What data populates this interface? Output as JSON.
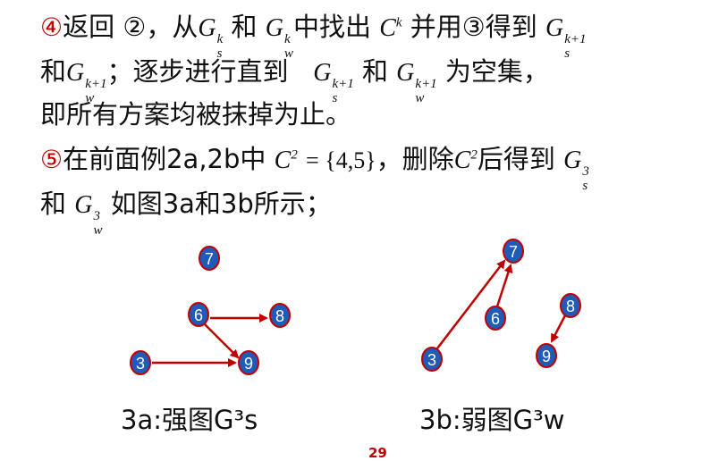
{
  "text": {
    "l1_circ": "④",
    "l1_a": "返回",
    "l1_circ2": "②",
    "l1_b": "，从",
    "l1_c": "和",
    "l1_d": "中找出",
    "l1_e": "并用",
    "l1_circ3": "③",
    "l1_f": "得到",
    "l2_a": "和",
    "l2_b": "；逐步进行直到",
    "l2_c": "和",
    "l2_d": "为空集，",
    "l3": "即所有方案均被抹掉为止。",
    "l4_circ": "⑤",
    "l4_a": "在前面例2a,2b中",
    "l4_set": "= {4,5}",
    "l4_b": "，删除",
    "l4_c": "后得到",
    "l5_a": "和",
    "l5_b": "如图3a和3b所示；",
    "G": "G",
    "C": "C",
    "k": "k",
    "kp1": "k+1",
    "sub_s": "s",
    "sub_w": "w",
    "sq": "2",
    "cube": "3"
  },
  "captions": {
    "fig_a": "3a:强图G³s",
    "fig_b": "3b:弱图G³w"
  },
  "page_number": "29",
  "graph_a": {
    "nodes": [
      "7",
      "6",
      "8",
      "3",
      "9"
    ],
    "edges": [
      [
        "6",
        "8"
      ],
      [
        "6",
        "9"
      ],
      [
        "3",
        "9"
      ]
    ]
  },
  "graph_b": {
    "nodes": [
      "7",
      "6",
      "8",
      "3",
      "9"
    ],
    "edges": [
      [
        "3",
        "7"
      ],
      [
        "6",
        "7"
      ],
      [
        "8",
        "9"
      ]
    ]
  },
  "colors": {
    "node_fill": "#1f5bb8",
    "node_stroke": "#c00000",
    "arrow": "#c00000",
    "accent": "#c00000"
  }
}
